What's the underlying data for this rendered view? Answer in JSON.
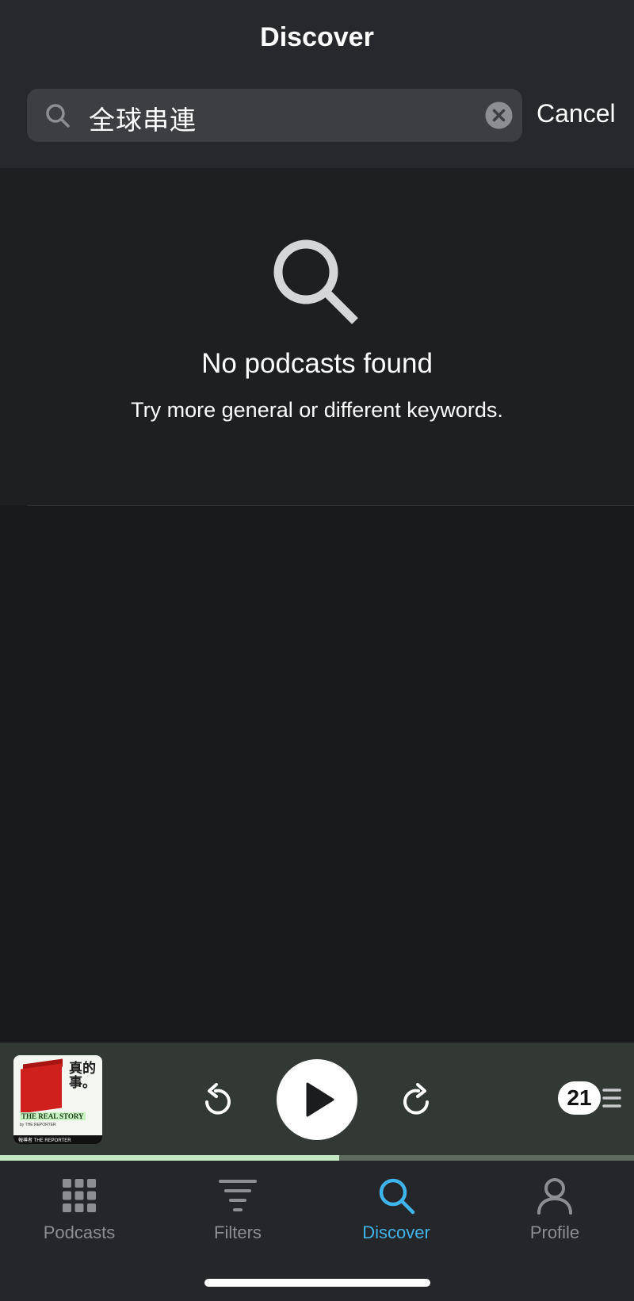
{
  "header": {
    "title": "Discover",
    "search": {
      "value": "全球串連",
      "icon": "search-icon",
      "clear_icon": "clear-circle-icon"
    },
    "cancel_label": "Cancel"
  },
  "empty_state": {
    "icon": "search-icon",
    "title": "No podcasts found",
    "subtitle": "Try more general or different keywords."
  },
  "player": {
    "artwork": {
      "cjk_title": "真的事。",
      "title": "THE REAL STORY",
      "byline": "by THE REPORTER",
      "footer": "報導者 THE REPORTER"
    },
    "skip_back_icon": "skip-back-icon",
    "play_icon": "play-icon",
    "skip_forward_icon": "skip-forward-icon",
    "queue_count": "21",
    "queue_icon": "queue-list-icon",
    "progress": 0.535
  },
  "tabs": [
    {
      "label": "Podcasts",
      "icon": "grid-icon",
      "active": false
    },
    {
      "label": "Filters",
      "icon": "filter-icon",
      "active": false
    },
    {
      "label": "Discover",
      "icon": "search-icon",
      "active": true
    },
    {
      "label": "Profile",
      "icon": "profile-icon",
      "active": false
    }
  ],
  "colors": {
    "accent": "#3fb5ec",
    "header_bg": "#27282b",
    "player_bg": "#323833",
    "progress_fill": "#c6e7c4"
  }
}
